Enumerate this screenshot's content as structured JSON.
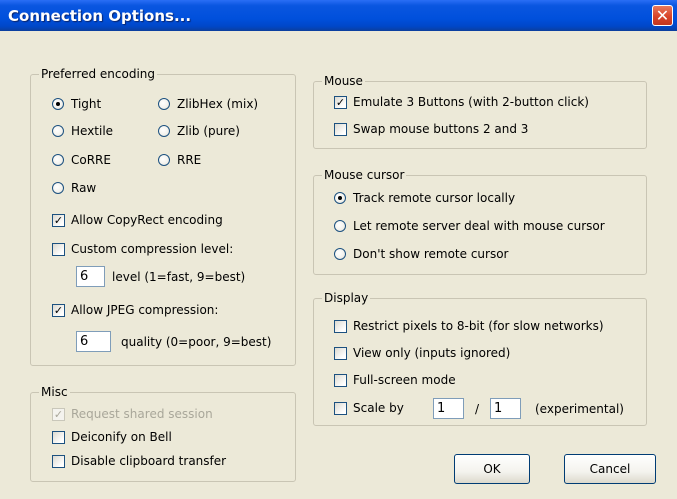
{
  "window": {
    "title": "Connection Options...",
    "close_symbol": "✕"
  },
  "encoding": {
    "legend": "Preferred encoding",
    "options": [
      "Tight",
      "ZlibHex (mix)",
      "Hextile",
      "Zlib (pure)",
      "CoRRE",
      "RRE",
      "Raw"
    ],
    "selected": "Tight",
    "copyrect": {
      "label": "Allow CopyRect encoding",
      "checked": true
    },
    "custom_compression": {
      "label": "Custom compression level:",
      "checked": false,
      "value": "6",
      "hint": "level (1=fast, 9=best)"
    },
    "jpeg": {
      "label": "Allow JPEG compression:",
      "checked": true,
      "value": "6",
      "hint": "quality (0=poor, 9=best)"
    }
  },
  "misc": {
    "legend": "Misc",
    "request_shared": {
      "label": "Request shared session",
      "checked": true,
      "disabled": true
    },
    "deiconify_bell": {
      "label": "Deiconify on Bell",
      "checked": false
    },
    "disable_clipboard": {
      "label": "Disable clipboard transfer",
      "checked": false
    }
  },
  "mouse": {
    "legend": "Mouse",
    "emulate3": {
      "label": "Emulate 3 Buttons (with 2-button click)",
      "checked": true
    },
    "swap": {
      "label": "Swap mouse buttons 2 and 3",
      "checked": false
    }
  },
  "cursor": {
    "legend": "Mouse cursor",
    "options": [
      "Track remote cursor locally",
      "Let remote server deal with mouse cursor",
      "Don't show remote cursor"
    ],
    "selected": "Track remote cursor locally"
  },
  "display": {
    "legend": "Display",
    "restrict8bit": {
      "label": "Restrict pixels to 8-bit (for slow networks)",
      "checked": false
    },
    "view_only": {
      "label": "View only (inputs ignored)",
      "checked": false
    },
    "fullscreen": {
      "label": "Full-screen mode",
      "checked": false
    },
    "scale": {
      "label": "Scale by",
      "checked": false,
      "num": "1",
      "separator": "/",
      "den": "1",
      "note": "(experimental)"
    }
  },
  "buttons": {
    "ok": "OK",
    "cancel": "Cancel"
  },
  "colors": {
    "titlebar": "#0050dc",
    "dialog_bg": "#ece9d8",
    "close_button": "#d9442a"
  }
}
